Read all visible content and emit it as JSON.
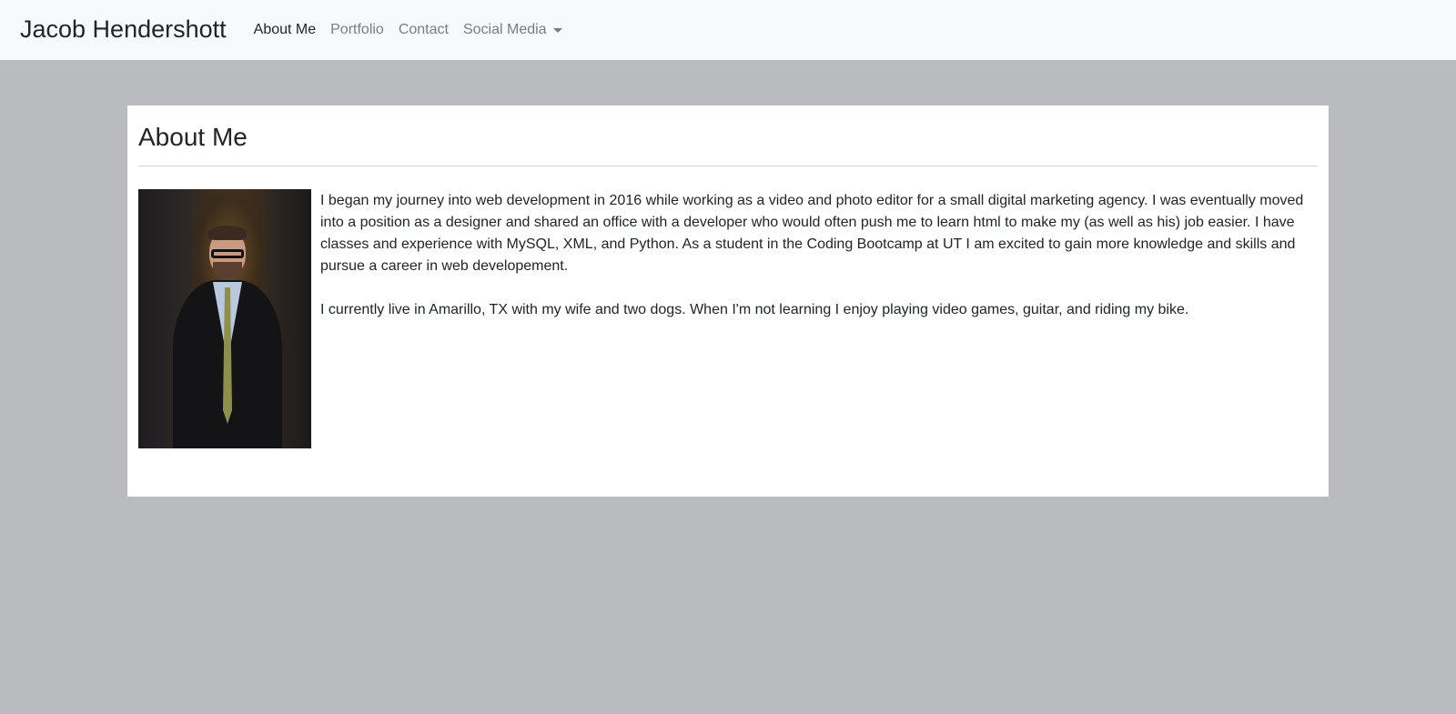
{
  "navbar": {
    "brand": "Jacob Hendershott",
    "links": [
      {
        "label": "About Me"
      },
      {
        "label": "Portfolio"
      },
      {
        "label": "Contact"
      },
      {
        "label": "Social Media"
      }
    ]
  },
  "about": {
    "heading": "About Me",
    "photo_alt": "Portrait photo",
    "paragraphs": [
      "I began my journey into web development in 2016 while working as a video and photo editor for a small digital marketing agency. I was eventually moved into a position as a designer and shared an office with a developer who would often push me to learn html to make my (as well as his) job easier. I have classes and experience with MySQL, XML, and Python. As a student in the Coding Bootcamp at UT I am excited to gain more knowledge and skills and pursue a career in web developement.",
      "I currently live in Amarillo, TX with my wife and two dogs. When I'm not learning I enjoy playing video games, guitar, and riding my bike."
    ]
  },
  "icons": {
    "dropdown": "chevron-down-icon"
  },
  "colors": {
    "page_background": "#babbbf",
    "navbar_background": "#f8f9fa",
    "card_background": "#ffffff",
    "active_link": "#212529",
    "inactive_link": "#7a7c80"
  }
}
